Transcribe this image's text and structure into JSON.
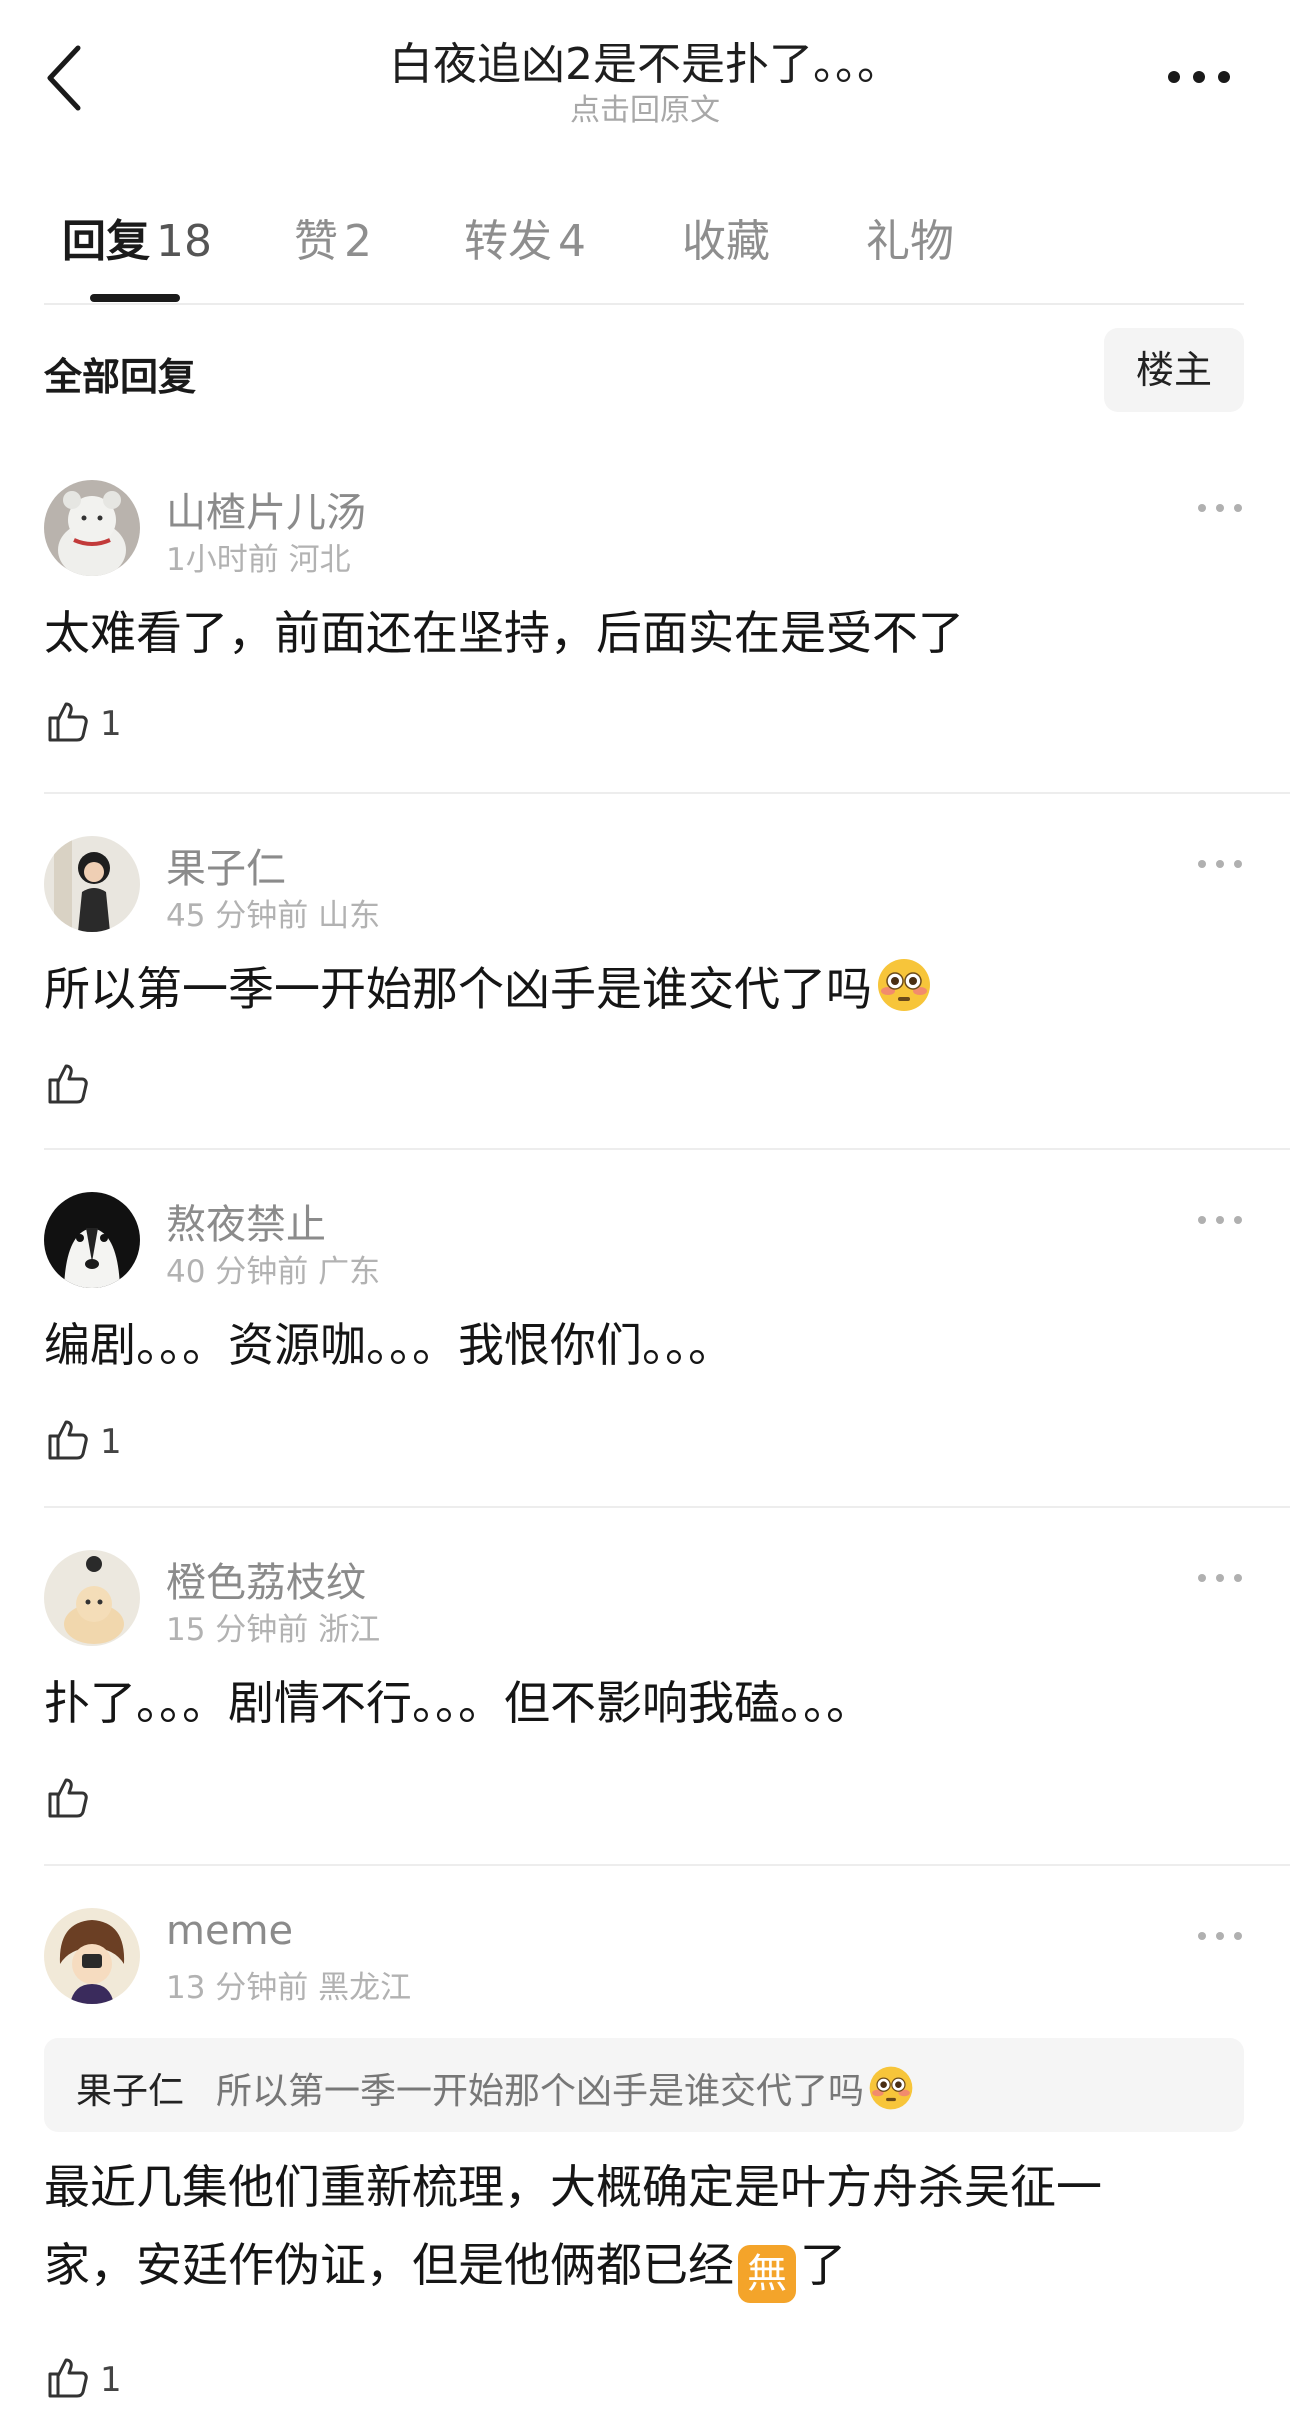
{
  "header": {
    "title": "白夜追凶2是不是扑了。。。",
    "subtitle": "点击回原文"
  },
  "tabs": [
    {
      "label": "回复",
      "count": "18"
    },
    {
      "label": "赞",
      "count": "2"
    },
    {
      "label": "转发",
      "count": "4"
    },
    {
      "label": "收藏",
      "count": ""
    },
    {
      "label": "礼物",
      "count": ""
    }
  ],
  "section": {
    "title": "全部回复",
    "op_label": "楼主"
  },
  "comments": [
    {
      "user": "山楂片儿汤",
      "time": "1小时前",
      "location": "河北",
      "text": "太难看了，前面还在坚持，后面实在是受不了",
      "likes": "1"
    },
    {
      "user": "果子仁",
      "time": "45 分钟前",
      "location": "山东",
      "text": "所以第一季一开始那个凶手是谁交代了吗",
      "emoji": "flushed-face",
      "likes": ""
    },
    {
      "user": "熬夜禁止",
      "time": "40 分钟前",
      "location": "广东",
      "text": "编剧。。。资源咖。。。我恨你们。。。",
      "likes": "1"
    },
    {
      "user": "橙色荔枝纹",
      "time": "15 分钟前",
      "location": "浙江",
      "text": "扑了。。。剧情不行。。。但不影响我磕。。。",
      "likes": ""
    },
    {
      "user": "meme",
      "time": "13 分钟前",
      "location": "黑龙江",
      "quote": {
        "user": "果子仁",
        "text": "所以第一季一开始那个凶手是谁交代了吗",
        "emoji": "flushed-face"
      },
      "text_line1": "最近几集他们重新梳理，大概确定是叶方舟杀吴征一",
      "text_line2_a": "家，安廷作伪证，但是他俩都已经",
      "emoji_badge": "無",
      "text_line2_b": "了",
      "likes": "1"
    }
  ]
}
